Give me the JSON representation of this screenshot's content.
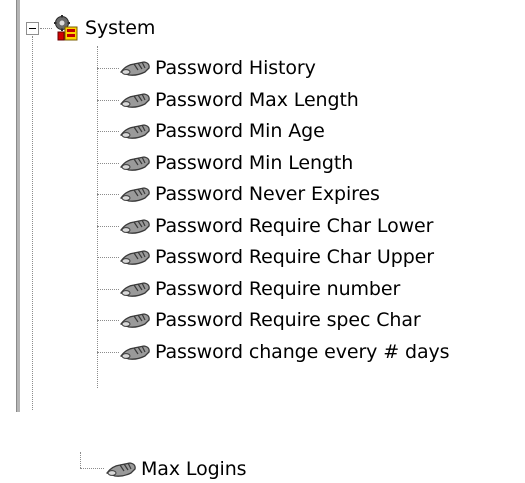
{
  "tree": {
    "root": {
      "label": "System",
      "icon": "system-icon",
      "expanded": true
    },
    "children": [
      {
        "label": "Password History",
        "icon": "key-icon"
      },
      {
        "label": "Password Max Length",
        "icon": "key-icon"
      },
      {
        "label": "Password Min Age",
        "icon": "key-icon"
      },
      {
        "label": "Password Min Length",
        "icon": "key-icon"
      },
      {
        "label": "Password Never Expires",
        "icon": "key-icon"
      },
      {
        "label": "Password Require Char Lower",
        "icon": "key-icon"
      },
      {
        "label": "Password Require Char Upper",
        "icon": "key-icon"
      },
      {
        "label": "Password Require number",
        "icon": "key-icon"
      },
      {
        "label": "Password Require spec Char",
        "icon": "key-icon"
      },
      {
        "label": "Password change every # days",
        "icon": "key-icon"
      }
    ],
    "sibling": {
      "label": "Max Logins",
      "icon": "key-icon"
    }
  }
}
